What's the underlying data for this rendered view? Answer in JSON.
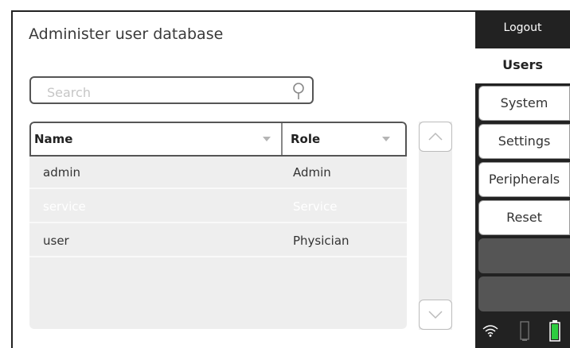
{
  "header": {
    "title": "Administer user database"
  },
  "search": {
    "placeholder": "Search"
  },
  "table": {
    "columns": [
      "Name",
      "Role"
    ],
    "rows": [
      {
        "name": "admin",
        "role": "Admin",
        "state": "normal"
      },
      {
        "name": "service",
        "role": "Service",
        "state": "disabled"
      },
      {
        "name": "user",
        "role": "Physician",
        "state": "normal"
      }
    ]
  },
  "sidebar": {
    "logout_label": "Logout",
    "tabs": [
      {
        "label": "Users",
        "active": true
      },
      {
        "label": "System",
        "active": false
      },
      {
        "label": "Settings",
        "active": false
      },
      {
        "label": "Peripherals",
        "active": false
      },
      {
        "label": "Reset",
        "active": false
      }
    ]
  },
  "status": {
    "icons": [
      "wifi-icon",
      "sensor-icon",
      "battery-icon"
    ],
    "battery_color": "#2ecc40"
  }
}
